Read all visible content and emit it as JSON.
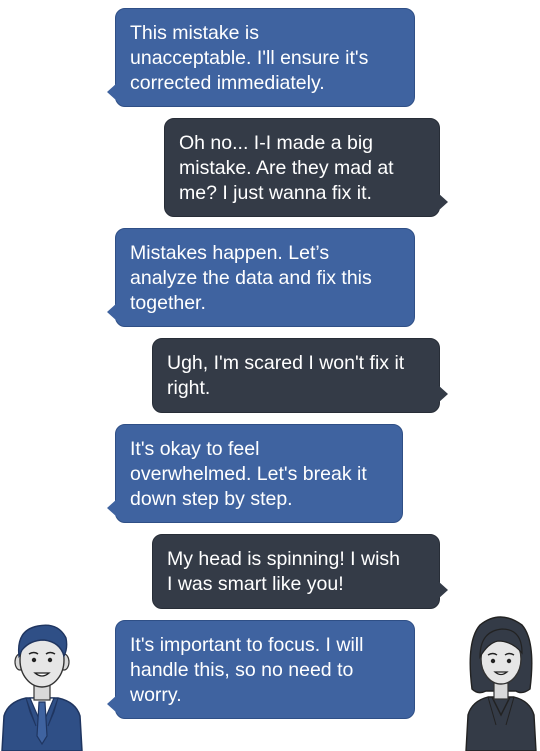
{
  "conversation": {
    "messages": [
      {
        "speaker": "left",
        "text": "This mistake is\nunacceptable. I'll ensure it's\ncorrected immediately."
      },
      {
        "speaker": "right",
        "text": "Oh no... I-I made a big\nmistake. Are they mad at\nme? I just wanna fix it."
      },
      {
        "speaker": "left",
        "text": "Mistakes happen. Let’s\nanalyze the data and fix this\ntogether."
      },
      {
        "speaker": "right",
        "text": "Ugh, I'm scared I won't fix it\nright."
      },
      {
        "speaker": "left",
        "text": "It's okay to feel\noverwhelmed. Let's break it\ndown step by step."
      },
      {
        "speaker": "right",
        "text": "My head is spinning! I wish\nI was smart like you!"
      },
      {
        "speaker": "left",
        "text": "It's important to focus. I will\nhandle this, so no need to\nworry."
      }
    ]
  },
  "colors": {
    "left_bubble": "#3f63a0",
    "right_bubble": "#343b47",
    "text": "#ffffff"
  },
  "icons": {
    "left_avatar": "man-avatar-icon",
    "right_avatar": "woman-avatar-icon"
  }
}
